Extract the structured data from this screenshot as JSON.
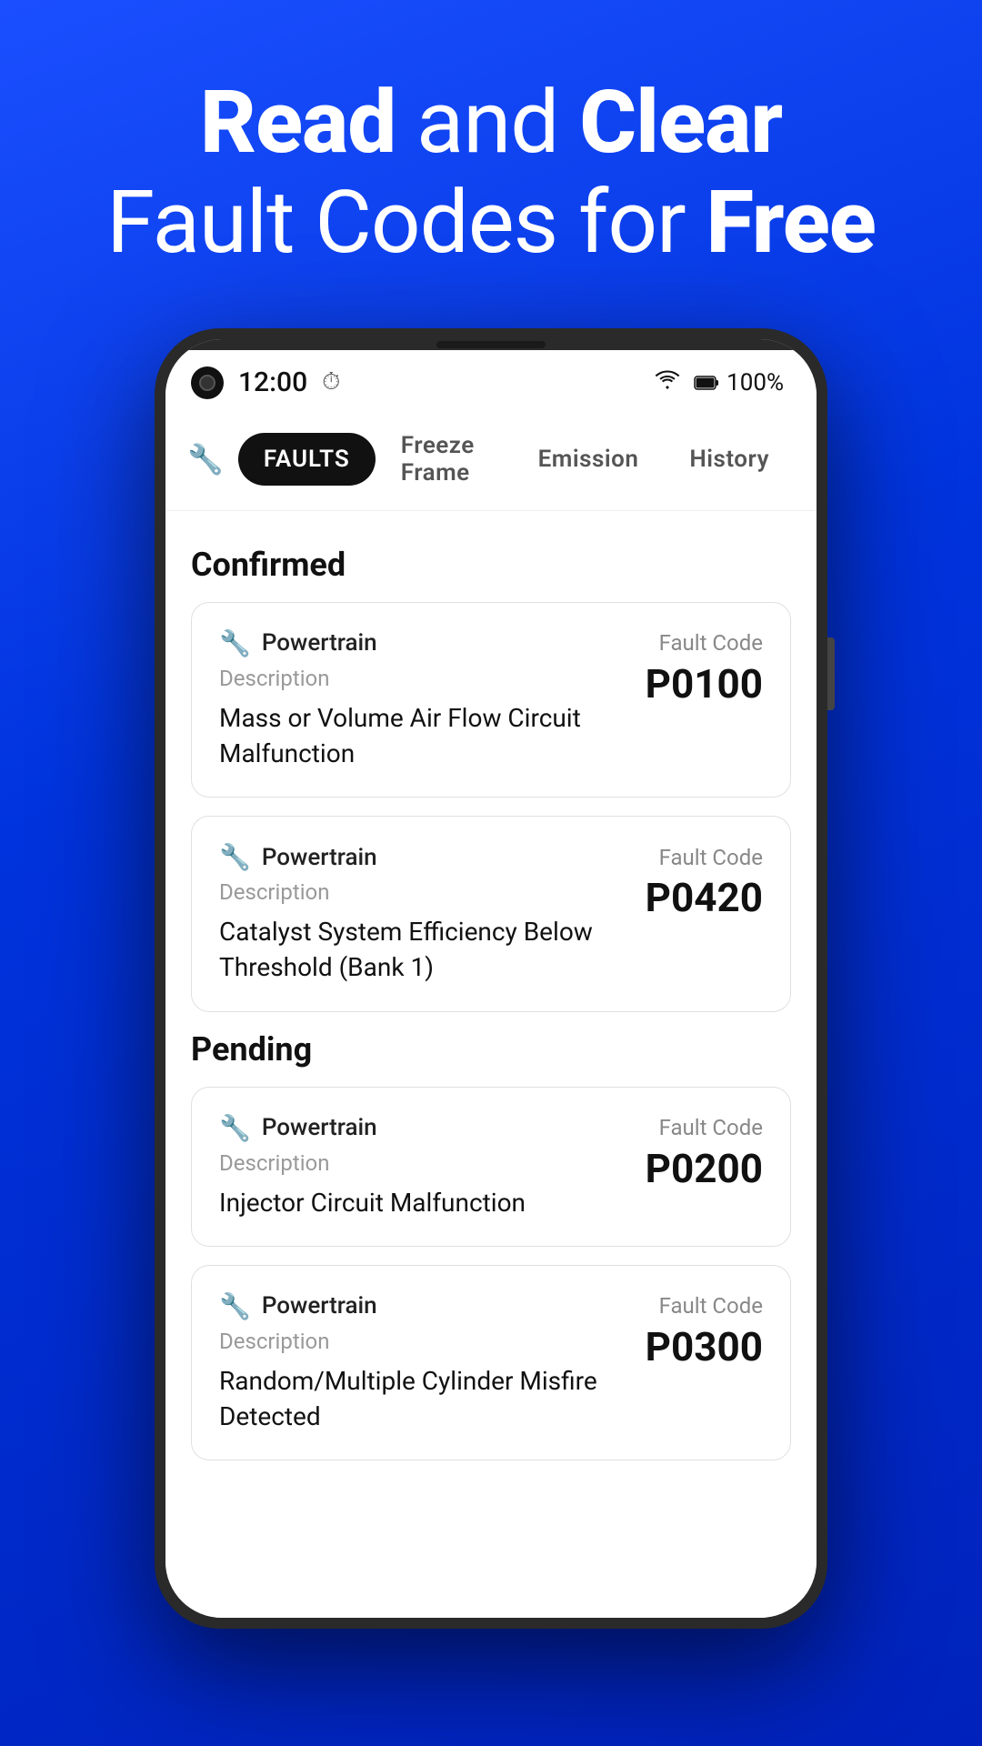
{
  "hero": {
    "line1_normal": "and",
    "line1_bold1": "Read",
    "line1_bold2": "Clear",
    "line2_normal": "Fault Codes for",
    "line2_bold": "Free"
  },
  "status_bar": {
    "time": "12:00",
    "battery": "100%"
  },
  "tabs": [
    {
      "id": "faults",
      "label": "Faults",
      "active": true
    },
    {
      "id": "freeze-frame",
      "label": "Freeze Frame",
      "active": false
    },
    {
      "id": "emission",
      "label": "Emission",
      "active": false
    },
    {
      "id": "history",
      "label": "History",
      "active": false
    }
  ],
  "sections": [
    {
      "title": "Confirmed",
      "faults": [
        {
          "system": "Powertrain",
          "fault_code_label": "Fault Code",
          "description_label": "Description",
          "code": "P0100",
          "description": "Mass or Volume Air Flow Circuit Malfunction"
        },
        {
          "system": "Powertrain",
          "fault_code_label": "Fault Code",
          "description_label": "Description",
          "code": "P0420",
          "description": "Catalyst System Efficiency Below Threshold (Bank 1)"
        }
      ]
    },
    {
      "title": "Pending",
      "faults": [
        {
          "system": "Powertrain",
          "fault_code_label": "Fault Code",
          "description_label": "Description",
          "code": "P0200",
          "description": "Injector Circuit Malfunction"
        },
        {
          "system": "Powertrain",
          "fault_code_label": "Fault Code",
          "description_label": "Description",
          "code": "P0300",
          "description": "Random/Multiple Cylinder Misfire Detected"
        }
      ]
    }
  ]
}
